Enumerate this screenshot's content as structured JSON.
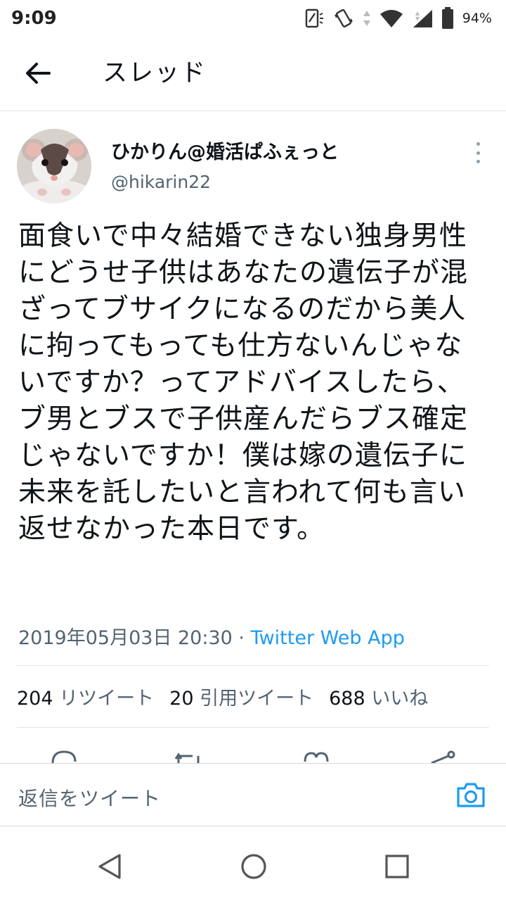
{
  "status_bar": {
    "time": "9:09",
    "battery_percent": "94%",
    "icons": [
      "nfc-icon",
      "vibrate-icon",
      "wifi-icon",
      "signal-icon",
      "battery-icon"
    ]
  },
  "header": {
    "title": "スレッド",
    "back_icon": "arrow-left-icon"
  },
  "tweet": {
    "author_name": "ひかりん@婚活ぱふぇっと",
    "author_handle": "@hikarin22",
    "avatar": "rat-avatar",
    "text": "面食いで中々結婚できない独身男性にどうせ子供はあなたの遺伝子が混ざってブサイクになるのだから美人に拘ってもっても仕方ないんじゃないですか？ってアドバイスしたら、ブ男とブスで子供産んだらブス確定じゃないですか！僕は嫁の遺伝子に未来を託したいと言われて何も言い返せなかった本日です。",
    "datetime": "2019年05月03日 20:30",
    "separator": " · ",
    "source": "Twitter Web App"
  },
  "stats": {
    "retweets_count": "204",
    "retweets_label": "リツイート",
    "quotes_count": "20",
    "quotes_label": "引用ツイート",
    "likes_count": "688",
    "likes_label": "いいね"
  },
  "actions": [
    "reply-icon",
    "retweet-icon",
    "like-icon",
    "share-icon"
  ],
  "reply_bar": {
    "placeholder": "返信をツイート",
    "camera_icon": "camera-icon"
  },
  "nav_bar": [
    "back-nav-icon",
    "home-nav-icon",
    "recents-nav-icon"
  ],
  "colors": {
    "accent": "#1d9bf0",
    "text_primary": "#0f1419",
    "text_secondary": "#536471",
    "divider": "#e1e4e8"
  }
}
